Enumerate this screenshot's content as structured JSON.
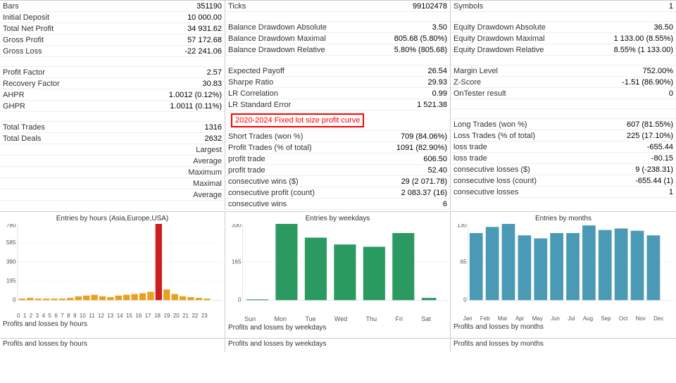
{
  "col1": {
    "rows": [
      {
        "label": "Bars",
        "value": "351190"
      },
      {
        "label": "Initial Deposit",
        "value": "10 000.00"
      },
      {
        "label": "Total Net Profit",
        "value": "34 931.62"
      },
      {
        "label": "Gross Profit",
        "value": "57 172.68"
      },
      {
        "label": "Gross Loss",
        "value": "-22 241.06"
      },
      {
        "label": "",
        "value": ""
      },
      {
        "label": "Profit Factor",
        "value": "2.57"
      },
      {
        "label": "Recovery Factor",
        "value": "30.83"
      },
      {
        "label": "AHPR",
        "value": "1.0012 (0.12%)"
      },
      {
        "label": "GHPR",
        "value": "1.0011 (0.11%)"
      },
      {
        "label": "",
        "value": ""
      },
      {
        "label": "Total Trades",
        "value": "1316"
      },
      {
        "label": "Total Deals",
        "value": "2632"
      },
      {
        "label": "Largest",
        "value": ""
      },
      {
        "label": "Average",
        "value": ""
      },
      {
        "label": "Maximum",
        "value": ""
      },
      {
        "label": "Maximal",
        "value": ""
      },
      {
        "label": "Average",
        "value": ""
      }
    ]
  },
  "col2": {
    "rows": [
      {
        "label": "Ticks",
        "value": "99102478"
      },
      {
        "label": "",
        "value": ""
      },
      {
        "label": "Balance Drawdown Absolute",
        "value": "3.50"
      },
      {
        "label": "Balance Drawdown Maximal",
        "value": "805.68 (5.80%)"
      },
      {
        "label": "Balance Drawdown Relative",
        "value": "5.80% (805.68)"
      },
      {
        "label": "",
        "value": ""
      },
      {
        "label": "Expected Payoff",
        "value": "26.54"
      },
      {
        "label": "Sharpe Ratio",
        "value": "29.93"
      },
      {
        "label": "LR Correlation",
        "value": "0.99"
      },
      {
        "label": "LR Standard Error",
        "value": "1 521.38"
      },
      {
        "label": "highlight",
        "value": "2020-2024 Fixed lot size profit curve"
      },
      {
        "label": "Short Trades (won %)",
        "value": "709 (84.06%)"
      },
      {
        "label": "Profit Trades (% of total)",
        "value": "1091 (82.90%)"
      },
      {
        "label": "profit trade",
        "value": "606.50"
      },
      {
        "label": "profit trade",
        "value": "52.40"
      },
      {
        "label": "consecutive wins ($)",
        "value": "29 (2 071.78)"
      },
      {
        "label": "consecutive profit (count)",
        "value": "2 083.37 (16)"
      },
      {
        "label": "consecutive wins",
        "value": "6"
      }
    ]
  },
  "col3": {
    "rows": [
      {
        "label": "Symbols",
        "value": "1"
      },
      {
        "label": "",
        "value": ""
      },
      {
        "label": "Equity Drawdown Absolute",
        "value": "36.50"
      },
      {
        "label": "Equity Drawdown Maximal",
        "value": "1 133.00 (8.55%)"
      },
      {
        "label": "Equity Drawdown Relative",
        "value": "8.55% (1 133.00)"
      },
      {
        "label": "",
        "value": ""
      },
      {
        "label": "Margin Level",
        "value": "752.00%"
      },
      {
        "label": "Z-Score",
        "value": "-1.51 (86.90%)"
      },
      {
        "label": "OnTester result",
        "value": "0"
      },
      {
        "label": "",
        "value": ""
      },
      {
        "label": "",
        "value": ""
      },
      {
        "label": "Long Trades (won %)",
        "value": "607 (81.55%)"
      },
      {
        "label": "Loss Trades (% of total)",
        "value": "225 (17.10%)"
      },
      {
        "label": "loss trade",
        "value": "-655.44"
      },
      {
        "label": "loss trade",
        "value": "-80.15"
      },
      {
        "label": "consecutive losses ($)",
        "value": "9 (-238.31)"
      },
      {
        "label": "consecutive loss (count)",
        "value": "-655.44 (1)"
      },
      {
        "label": "consecutive losses",
        "value": "1"
      }
    ]
  },
  "charts": {
    "chart1": {
      "title": "Entries by hours (Asia,Europe,USA)",
      "ymax": "780",
      "ymid1": "585",
      "ymid2": "390",
      "ymid3": "195",
      "xLabels": [
        "0",
        "1",
        "2",
        "3",
        "4",
        "5",
        "6",
        "7",
        "8",
        "9",
        "10",
        "11",
        "12",
        "13",
        "14",
        "15",
        "16",
        "17",
        "18",
        "19",
        "20",
        "21",
        "22",
        "23"
      ],
      "bars": [
        10,
        5,
        3,
        3,
        2,
        2,
        3,
        8,
        12,
        15,
        10,
        8,
        12,
        15,
        18,
        20,
        25,
        780,
        30,
        15,
        10,
        8,
        5,
        3
      ],
      "bottomLabel": "Profits and losses by hours"
    },
    "chart2": {
      "title": "Entries by weekdays",
      "ymax": "330",
      "ymid1": "165",
      "xLabels": [
        "Sun",
        "Mon",
        "Tue",
        "Wed",
        "Thu",
        "Fri",
        "Sat"
      ],
      "bars": [
        5,
        330,
        270,
        240,
        230,
        290,
        10
      ],
      "bottomLabel": "Profits and losses by weekdays"
    },
    "chart3": {
      "title": "Entries by months",
      "ymax": "130",
      "ymid1": "65",
      "xLabels": [
        "Jan",
        "Feb",
        "Mar",
        "Apr",
        "May",
        "Jun",
        "Jul",
        "Aug",
        "Sep",
        "Oct",
        "Nov",
        "Dec"
      ],
      "bars": [
        115,
        125,
        130,
        110,
        105,
        115,
        115,
        128,
        120,
        122,
        118,
        110
      ],
      "bottomLabel": "Profits and losses by months"
    }
  }
}
